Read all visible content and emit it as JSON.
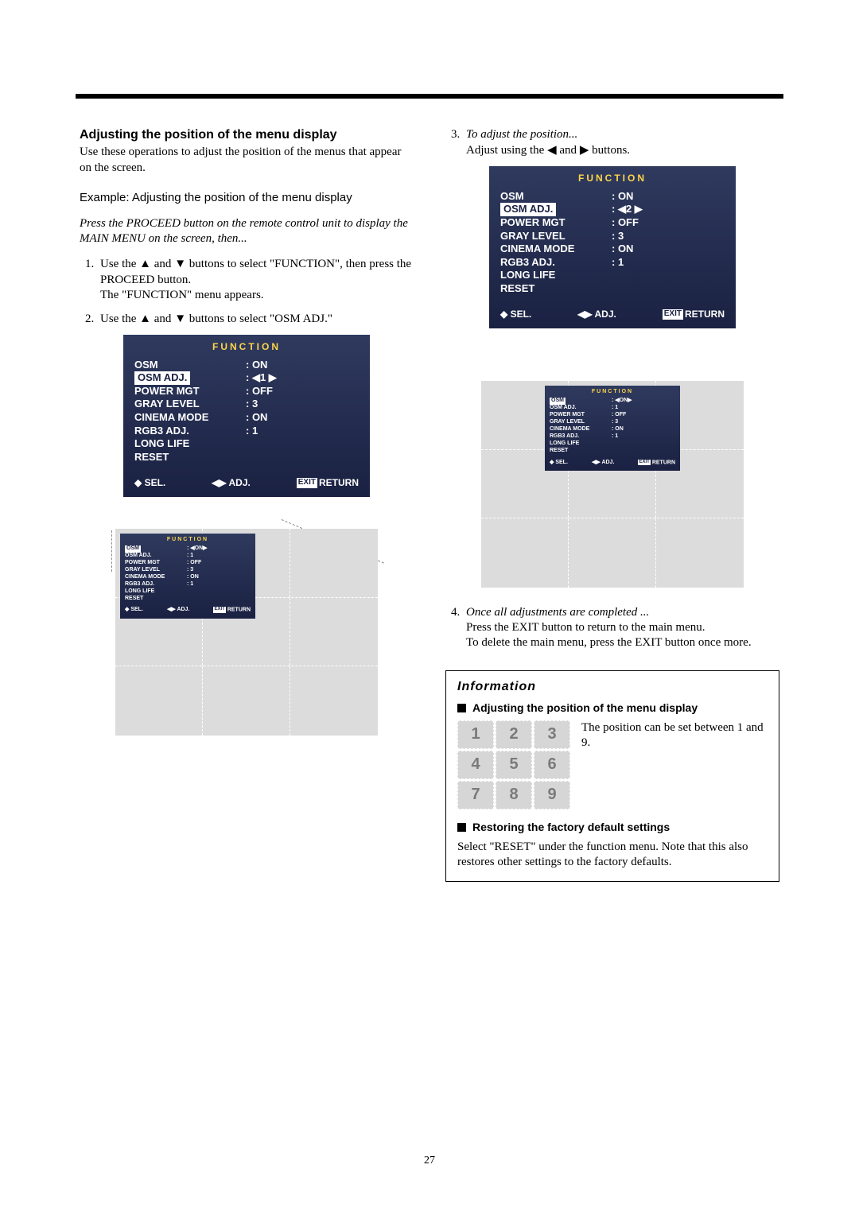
{
  "page_number": "27",
  "left": {
    "heading": "Adjusting the position of the menu display",
    "intro": "Use these operations to adjust the position of the menus that appear on the screen.",
    "example": "Example: Adjusting the position of the menu display",
    "press": "Press the PROCEED button on the remote control unit to display the MAIN MENU on the screen, then...",
    "step1a": "Use the ",
    "tri_up": "▲",
    "step1b": " and ",
    "tri_down": "▼",
    "step1c": " buttons to select \"FUNCTION\", then press the PROCEED button.",
    "step1d": "The \"FUNCTION\" menu appears.",
    "step2a": "Use the ",
    "step2b": " and ",
    "step2c": " buttons to select \"OSM ADJ.\""
  },
  "right": {
    "step3_lead": "To adjust the position...",
    "step3_body_a": "Adjust using the ",
    "tri_left": "◀",
    "step3_body_b": " and ",
    "tri_right": "▶",
    "step3_body_c": " buttons.",
    "step4_lead": "Once all adjustments are completed ...",
    "step4_body1": "Press the EXIT button to return to the main menu.",
    "step4_body2": "To delete the main menu, press the EXIT button once more."
  },
  "osd": {
    "title": "FUNCTION",
    "rows": [
      {
        "label": "OSM",
        "value": ": ON",
        "hl": false
      },
      {
        "label": "OSM ADJ.",
        "value": ": ◀1 ▶",
        "hl": true
      },
      {
        "label": "POWER MGT",
        "value": ": OFF",
        "hl": false
      },
      {
        "label": "GRAY LEVEL",
        "value": ": 3",
        "hl": false
      },
      {
        "label": "CINEMA MODE",
        "value": ": ON",
        "hl": false
      },
      {
        "label": "RGB3 ADJ.",
        "value": ": 1",
        "hl": false
      },
      {
        "label": "LONG LIFE",
        "value": "",
        "hl": false
      },
      {
        "label": "RESET",
        "value": "",
        "hl": false
      }
    ],
    "sel": "SEL.",
    "adj": "ADJ.",
    "exit": "EXIT",
    "return": "RETURN"
  },
  "osd_left_mini": {
    "rows": [
      {
        "label": "OSM",
        "value": ": ◀ON▶",
        "hl": true
      },
      {
        "label": "OSM ADJ.",
        "value": ": 1",
        "hl": false
      },
      {
        "label": "POWER MGT",
        "value": ": OFF",
        "hl": false
      },
      {
        "label": "GRAY LEVEL",
        "value": ": 3",
        "hl": false
      },
      {
        "label": "CINEMA MODE",
        "value": ": ON",
        "hl": false
      },
      {
        "label": "RGB3 ADJ.",
        "value": ": 1",
        "hl": false
      },
      {
        "label": "LONG LIFE",
        "value": "",
        "hl": false
      },
      {
        "label": "RESET",
        "value": "",
        "hl": false
      }
    ]
  },
  "osd_right": {
    "rows": [
      {
        "label": "OSM",
        "value": ": ON",
        "hl": false
      },
      {
        "label": "OSM ADJ.",
        "value": ": ◀2 ▶",
        "hl": true
      },
      {
        "label": "POWER MGT",
        "value": ": OFF",
        "hl": false
      },
      {
        "label": "GRAY LEVEL",
        "value": ": 3",
        "hl": false
      },
      {
        "label": "CINEMA MODE",
        "value": ": ON",
        "hl": false
      },
      {
        "label": "RGB3 ADJ.",
        "value": ": 1",
        "hl": false
      },
      {
        "label": "LONG LIFE",
        "value": "",
        "hl": false
      },
      {
        "label": "RESET",
        "value": "",
        "hl": false
      }
    ]
  },
  "osd_right_mini": {
    "rows": [
      {
        "label": "OSM",
        "value": ": ◀ON▶",
        "hl": true
      },
      {
        "label": "OSM ADJ.",
        "value": ": 1",
        "hl": false
      },
      {
        "label": "POWER MGT",
        "value": ": OFF",
        "hl": false
      },
      {
        "label": "GRAY LEVEL",
        "value": ": 3",
        "hl": false
      },
      {
        "label": "CINEMA MODE",
        "value": ": ON",
        "hl": false
      },
      {
        "label": "RGB3 ADJ.",
        "value": ": 1",
        "hl": false
      },
      {
        "label": "LONG LIFE",
        "value": "",
        "hl": false
      },
      {
        "label": "RESET",
        "value": "",
        "hl": false
      }
    ]
  },
  "info": {
    "head": "Information",
    "sub1": "Adjusting the position of the menu display",
    "body1": "The position can be set between 1 and 9.",
    "grid": [
      "1",
      "2",
      "3",
      "4",
      "5",
      "6",
      "7",
      "8",
      "9"
    ],
    "sub2": "Restoring the factory default settings",
    "body2": "Select \"RESET\" under the function menu. Note that this also restores other settings to the factory defaults."
  }
}
